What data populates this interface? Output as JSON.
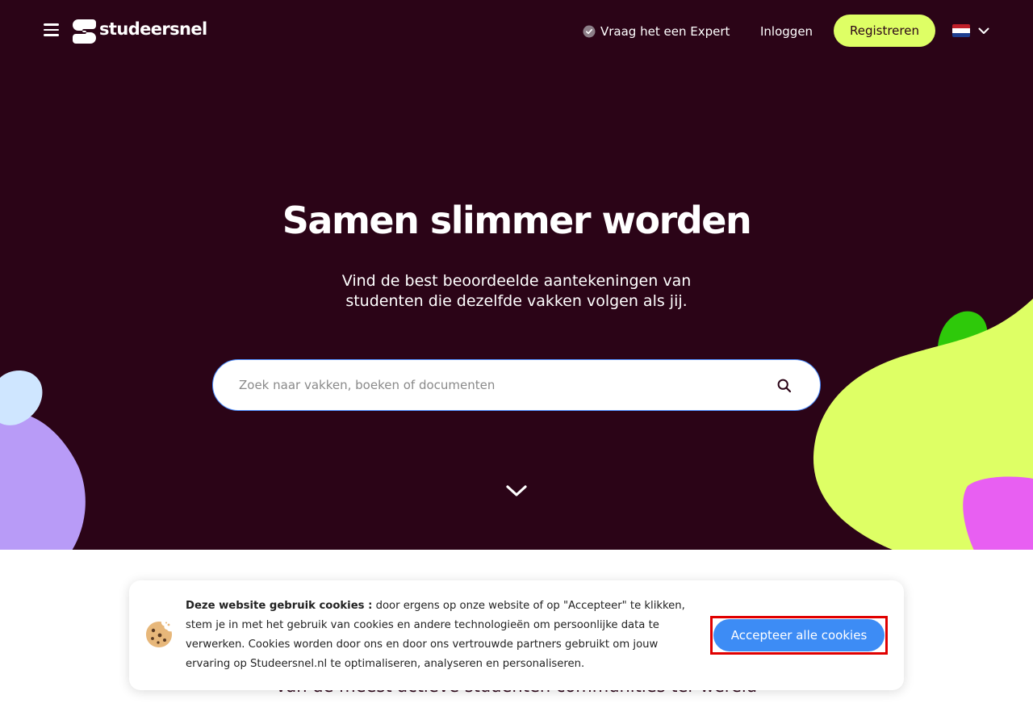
{
  "nav": {
    "logo_text": "studeersnel",
    "expert_label": "Vraag het een Expert",
    "login_label": "Inloggen",
    "register_label": "Registreren",
    "language_flag": "netherlands-flag"
  },
  "hero": {
    "title": "Samen slimmer worden",
    "subtitle": "Vind de best beoordeelde aantekeningen van studenten die dezelfde vakken volgen als jij.",
    "search_placeholder": "Zoek naar vakken, boeken of documenten"
  },
  "section": {
    "partial_text": "van de meest actieve studenten communities ter wereld"
  },
  "cookie_banner": {
    "title": "Deze website gebruik cookies :",
    "body": " door ergens op onze website of op \"Accepteer\" te klikken, stem je in met het gebruik van cookies en andere technologieën om persoonlijke data te verwerken. Cookies worden door ons en door ons vertrouwde partners gebruikt om jouw ervaring op Studeersnel.nl te optimaliseren, analyseren en personaliseren.",
    "accept_label": "Accepteer alle cookies"
  },
  "colors": {
    "hero_background": "#2b0417",
    "register_button": "#deff65",
    "accept_button": "#3d8cf5",
    "blob_lime": "#deff65",
    "blob_green": "#2ec90a",
    "blob_pink": "#e85ff2",
    "blob_lavender": "#b89bf7",
    "blob_lightblue": "#cfe6ff"
  }
}
